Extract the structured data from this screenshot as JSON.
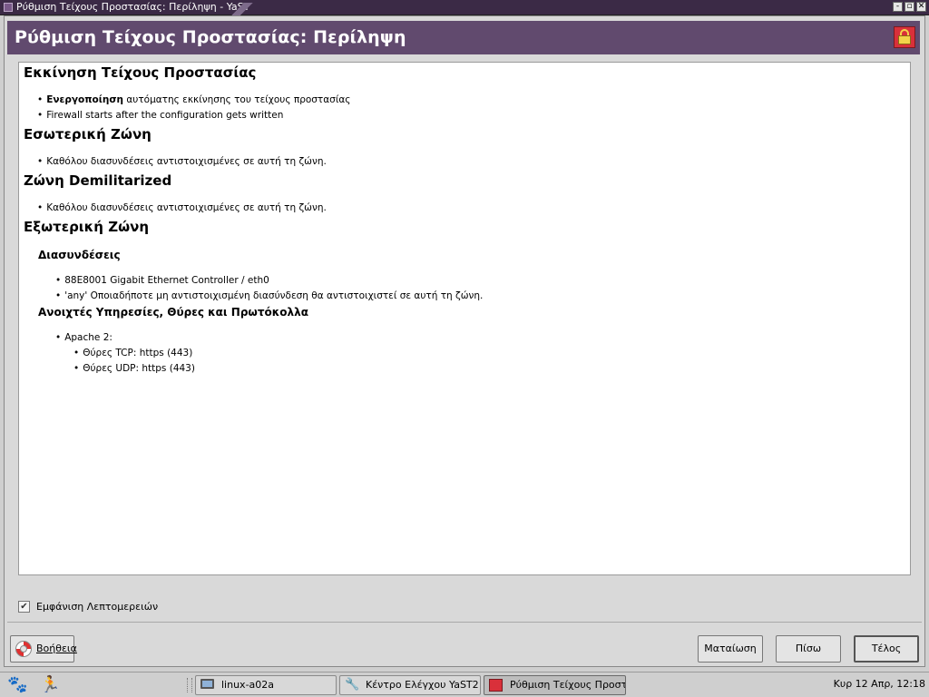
{
  "window": {
    "title": "Ρύθμιση Τείχους Προστασίας: Περίληψη - YaST",
    "btn_minimize": "-",
    "btn_maximize": "▫",
    "btn_close": "✕"
  },
  "header": {
    "title": "Ρύθμιση Τείχους Προστασίας: Περίληψη",
    "icon": "firewall-lock-icon"
  },
  "summary": {
    "startup": {
      "heading": "Εκκίνηση Τείχους Προστασίας",
      "item1_bold": "Ενεργοποίηση",
      "item1_rest": " αυτόματης εκκίνησης του τείχους προστασίας",
      "item2": "Firewall starts after the configuration gets written"
    },
    "internal": {
      "heading": "Εσωτερική Ζώνη",
      "item1": "Καθόλου διασυνδέσεις αντιστοιχισμένες σε αυτή τη ζώνη."
    },
    "dmz": {
      "heading": "Ζώνη Demilitarized",
      "item1": "Καθόλου διασυνδέσεις αντιστοιχισμένες σε αυτή τη ζώνη."
    },
    "external": {
      "heading": "Εξωτερική Ζώνη",
      "interfaces_heading": "Διασυνδέσεις",
      "interface1": "88E8001 Gigabit Ethernet Controller / eth0",
      "interface2": "'any' Οποιαδήποτε μη αντιστοιχισμένη διασύνδεση θα αντιστοιχιστεί σε αυτή τη ζώνη.",
      "services_heading": "Ανοιχτές Υπηρεσίες, Θύρες και Πρωτόκολλα",
      "service1": "Apache 2:",
      "service1_tcp": "Θύρες TCP: https (443)",
      "service1_udp": "Θύρες UDP: https (443)"
    }
  },
  "bullet": "•",
  "details_checkbox": {
    "label": "Εμφάνιση Λεπτομερειών",
    "checked": true,
    "mark": "✔"
  },
  "buttons": {
    "help": "Βοήθεια",
    "abort": "Ματαίωση",
    "back": "Πίσω",
    "finish": "Τέλος"
  },
  "taskbar": {
    "tasks": [
      {
        "label": "linux-a02a",
        "icon": "monitor-icon"
      },
      {
        "label": "Κέντρο Ελέγχου YaST2",
        "icon": "yast-control-center-icon"
      },
      {
        "label": "Ρύθμιση Τείχους Προστ...",
        "icon": "firewall-icon"
      }
    ],
    "clock": "Κυρ 12 Απρ, 12:18"
  }
}
